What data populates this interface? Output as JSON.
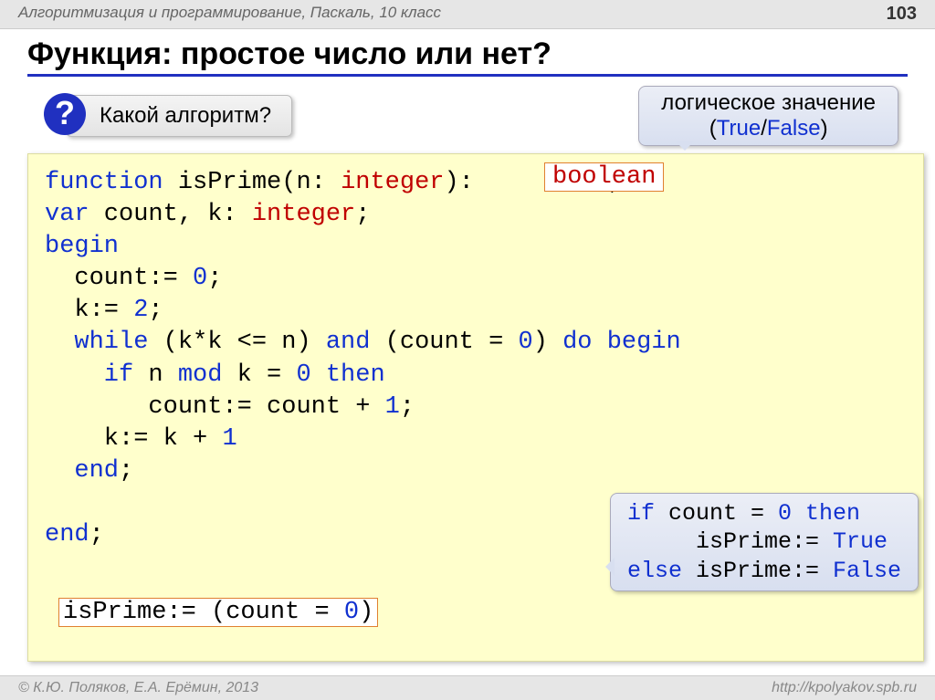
{
  "header": {
    "course": "Алгоритмизация и программирование, Паскаль, 10 класс",
    "page": "103"
  },
  "title": "Функция: простое число или нет?",
  "question_mark": "?",
  "question_text": "Какой алгоритм?",
  "log_bubble": {
    "line1": "логическое значение",
    "paren_open": "(",
    "true_word": "True",
    "slash": "/",
    "false_word": "False",
    "paren_close": ")"
  },
  "code": {
    "l1a": "function",
    "l1b": " isPrime(n: ",
    "l1c": "integer",
    "l1d": "):",
    "l1e": " ;",
    "l2a": "var",
    "l2b": " count, k: ",
    "l2c": "integer",
    "l2d": ";",
    "l3": "begin",
    "l4a": "  count:= ",
    "l4b": "0",
    "l4c": ";",
    "l5a": "  k:= ",
    "l5b": "2",
    "l5c": ";",
    "l6a": "  while",
    "l6b": " (k*k <= n) ",
    "l6c": "and",
    "l6d": " (count = ",
    "l6e": "0",
    "l6f": ") ",
    "l6g": "do begin",
    "l7a": "    if",
    "l7b": " n ",
    "l7c": "mod",
    "l7d": " k = ",
    "l7e": "0",
    "l7f": " ",
    "l7g": "then",
    "l8a": "       count:= count + ",
    "l8b": "1",
    "l8c": ";",
    "l9a": "    k:= k + ",
    "l9b": "1",
    "l10": "  end",
    "l10b": ";",
    "l11spacer": " ",
    "l12": "end",
    "l12b": ";"
  },
  "boolean_box": "boolean",
  "isprime_box": {
    "a": "isPrime:= (count = ",
    "b": "0",
    "c": ")"
  },
  "explain": {
    "l1a": "if",
    "l1b": " count = ",
    "l1c": "0",
    "l1d": " ",
    "l1e": "then",
    "l2a": "     isPrime:= ",
    "l2b": "True",
    "l3a": "else",
    "l3b": " isPrime:= ",
    "l3c": "False"
  },
  "footer": {
    "left": "© К.Ю. Поляков, Е.А. Ерёмин, 2013",
    "right": "http://kpolyakov.spb.ru"
  }
}
